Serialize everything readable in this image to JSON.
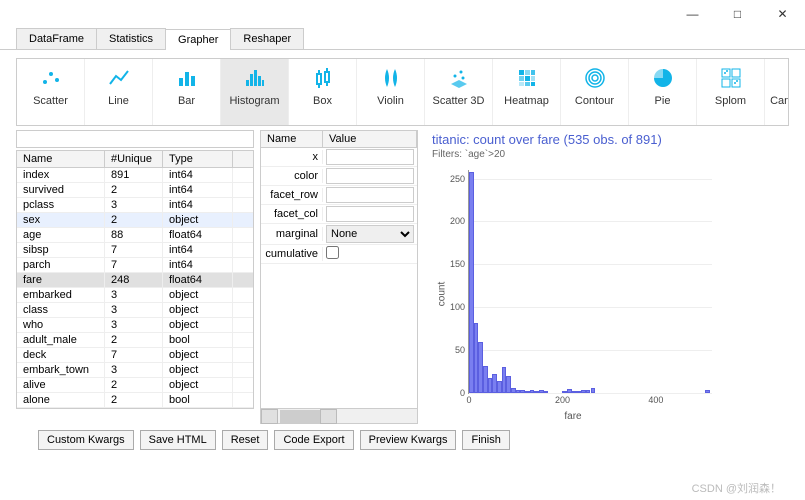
{
  "window": {
    "min": "—",
    "max": "□",
    "close": "✕"
  },
  "tabs": [
    "DataFrame",
    "Statistics",
    "Grapher",
    "Reshaper"
  ],
  "active_tab": 2,
  "tools": [
    "Scatter",
    "Line",
    "Bar",
    "Histogram",
    "Box",
    "Violin",
    "Scatter 3D",
    "Heatmap",
    "Contour",
    "Pie",
    "Splom",
    "Candlestick V"
  ],
  "selected_tool": 3,
  "schema": {
    "headers": [
      "Name",
      "#Unique",
      "Type"
    ],
    "rows": [
      {
        "name": "index",
        "uniq": "891",
        "type": "int64"
      },
      {
        "name": "survived",
        "uniq": "2",
        "type": "int64"
      },
      {
        "name": "pclass",
        "uniq": "3",
        "type": "int64"
      },
      {
        "name": "sex",
        "uniq": "2",
        "type": "object",
        "hl": 1
      },
      {
        "name": "age",
        "uniq": "88",
        "type": "float64"
      },
      {
        "name": "sibsp",
        "uniq": "7",
        "type": "int64"
      },
      {
        "name": "parch",
        "uniq": "7",
        "type": "int64"
      },
      {
        "name": "fare",
        "uniq": "248",
        "type": "float64",
        "hl": 2
      },
      {
        "name": "embarked",
        "uniq": "3",
        "type": "object"
      },
      {
        "name": "class",
        "uniq": "3",
        "type": "object"
      },
      {
        "name": "who",
        "uniq": "3",
        "type": "object"
      },
      {
        "name": "adult_male",
        "uniq": "2",
        "type": "bool"
      },
      {
        "name": "deck",
        "uniq": "7",
        "type": "object"
      },
      {
        "name": "embark_town",
        "uniq": "3",
        "type": "object"
      },
      {
        "name": "alive",
        "uniq": "2",
        "type": "object"
      },
      {
        "name": "alone",
        "uniq": "2",
        "type": "bool"
      }
    ]
  },
  "params": {
    "headers": [
      "Name",
      "Value"
    ],
    "rows": [
      {
        "label": "x",
        "kind": "text",
        "value": ""
      },
      {
        "label": "color",
        "kind": "text",
        "value": ""
      },
      {
        "label": "facet_row",
        "kind": "text",
        "value": ""
      },
      {
        "label": "facet_col",
        "kind": "text",
        "value": ""
      },
      {
        "label": "marginal",
        "kind": "select",
        "value": "None"
      },
      {
        "label": "cumulative",
        "kind": "check",
        "value": false
      }
    ]
  },
  "chart_data": {
    "type": "bar",
    "title": "titanic:  count over fare (535 obs. of 891)",
    "subtitle": "Filters: `age`>20",
    "xlabel": "fare",
    "ylabel": "count",
    "ylim": [
      0,
      260
    ],
    "yticks": [
      0,
      50,
      100,
      150,
      200,
      250
    ],
    "xticks": [
      0,
      200,
      400
    ],
    "xlim": [
      0,
      520
    ],
    "x": [
      5,
      15,
      25,
      35,
      45,
      55,
      65,
      75,
      85,
      95,
      105,
      115,
      125,
      135,
      145,
      155,
      165,
      175,
      185,
      195,
      205,
      215,
      225,
      235,
      245,
      255,
      265,
      510
    ],
    "values": [
      258,
      82,
      60,
      32,
      18,
      22,
      14,
      30,
      20,
      6,
      4,
      3,
      2,
      4,
      2,
      3,
      1,
      0,
      0,
      0,
      2,
      5,
      1,
      2,
      4,
      4,
      6,
      4
    ]
  },
  "buttons": [
    "Custom Kwargs",
    "Save HTML",
    "Reset",
    "Code Export",
    "Preview Kwargs",
    "Finish"
  ],
  "watermark": "CSDN @刘润森！"
}
